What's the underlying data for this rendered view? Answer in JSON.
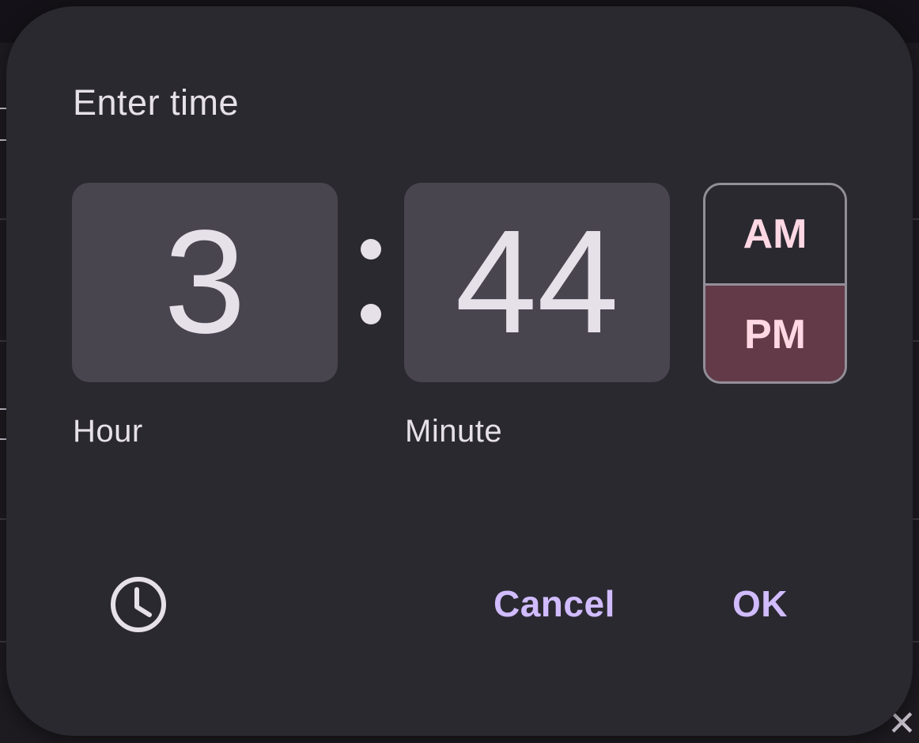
{
  "dialog": {
    "title": "Enter time",
    "hour": "3",
    "minute": "44",
    "hour_label": "Hour",
    "minute_label": "Minute",
    "period": {
      "options": [
        "AM",
        "PM"
      ],
      "selected": "PM"
    },
    "mode_toggle_icon": "clock-icon",
    "actions": {
      "cancel": "Cancel",
      "ok": "OK"
    }
  },
  "colors": {
    "surface": "#2b2930",
    "field": "#49454f",
    "selected_period": "#633b48",
    "period_text": "#ffd8e4",
    "action_text": "#d0bcff",
    "on_surface": "#e6e0e9"
  }
}
